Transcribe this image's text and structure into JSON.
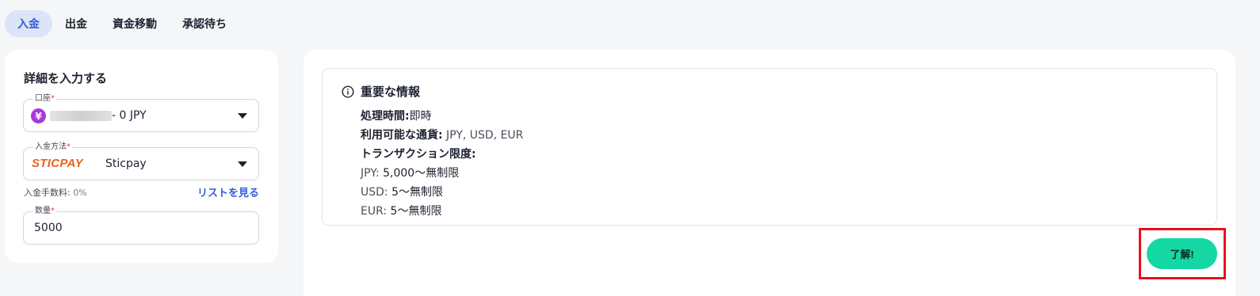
{
  "tabs": [
    {
      "label": "入金",
      "active": true
    },
    {
      "label": "出金",
      "active": false
    },
    {
      "label": "資金移動",
      "active": false
    },
    {
      "label": "承認待ち",
      "active": false
    }
  ],
  "form": {
    "title": "詳細を入力する",
    "account": {
      "label": "口座",
      "required_mark": "*",
      "currency_icon": "¥",
      "balance_text": "- 0 JPY"
    },
    "method": {
      "label": "入金方法",
      "required_mark": "*",
      "logo_text": "STICPAY",
      "value": "Sticpay"
    },
    "fee": {
      "label": "入金手数料:",
      "value": "0%"
    },
    "list_link": "リストを見る",
    "amount": {
      "label": "数量",
      "required_mark": "*",
      "value": "5000"
    }
  },
  "info": {
    "title": "重要な情報",
    "processing_label": "処理時間:",
    "processing_value": "即時",
    "currencies_label": "利用可能な通貨:",
    "currencies_value": " JPY, USD, EUR",
    "limits_label": "トランザクション限度:",
    "limits": [
      {
        "currency": "JPY:",
        "range": " 5,000〜無制限"
      },
      {
        "currency": "USD:",
        "range": " 5〜無制限"
      },
      {
        "currency": "EUR:",
        "range": " 5〜無制限"
      }
    ]
  },
  "ok_button": "了解!",
  "colors": {
    "accent": "#2f5fd8",
    "button": "#14d8a3",
    "highlight": "#e8101c",
    "yen_icon": "#a73ad9",
    "sticpay": "#e8641c"
  }
}
